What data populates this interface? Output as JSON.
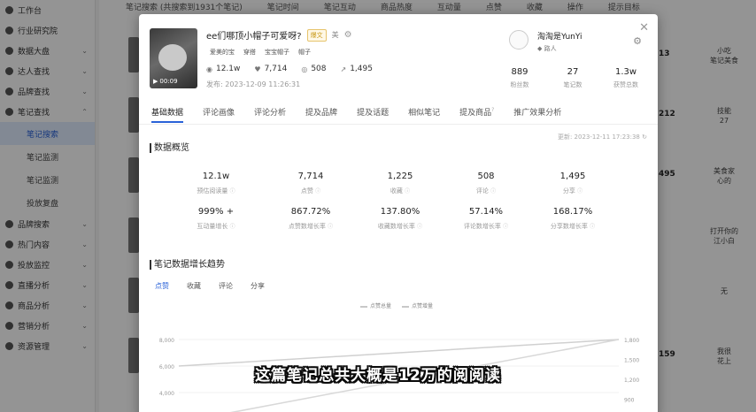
{
  "sidebar": {
    "items": [
      {
        "label": "工作台",
        "sub": false
      },
      {
        "label": "行业研究院",
        "sub": false
      },
      {
        "label": "数据大盘",
        "sub": false,
        "chevron": "⌄"
      },
      {
        "label": "达人查找",
        "sub": false,
        "chevron": "⌄"
      },
      {
        "label": "品牌查找",
        "sub": false,
        "chevron": "⌄"
      },
      {
        "label": "笔记查找",
        "sub": false,
        "chevron": "⌃"
      },
      {
        "label": "笔记搜索",
        "sub": true,
        "active": true
      },
      {
        "label": "笔记监测",
        "sub": true
      },
      {
        "label": "笔记监测",
        "sub": true
      },
      {
        "label": "投放复盘",
        "sub": true
      },
      {
        "label": "品牌搜索",
        "sub": false,
        "chevron": "⌄"
      },
      {
        "label": "热门内容",
        "sub": false,
        "chevron": "⌄"
      },
      {
        "label": "投放监控",
        "sub": false,
        "chevron": "⌄"
      },
      {
        "label": "直播分析",
        "sub": false,
        "chevron": "⌄"
      },
      {
        "label": "商品分析",
        "sub": false,
        "chevron": "⌄"
      },
      {
        "label": "营销分析",
        "sub": false,
        "chevron": "⌄"
      },
      {
        "label": "资源管理",
        "sub": false,
        "chevron": "⌄"
      }
    ]
  },
  "background": {
    "topbar": [
      "笔记搜索 (共搜索到1931个笔记)",
      "笔记时间",
      "笔记互动",
      "商品热度",
      "互动量",
      "点赞",
      "收藏",
      "操作",
      "提示目标"
    ],
    "rows": [
      {
        "num": "13",
        "txt": "小吃\n笔记美食"
      },
      {
        "num": "212",
        "txt": "技能\n27"
      },
      {
        "num": "495",
        "txt": "美食家\n心的"
      },
      {
        "num": "",
        "txt": "打开你的\n江小白"
      },
      {
        "num": "",
        "txt": "无"
      },
      {
        "num": "159",
        "txt": "我很\n花上"
      }
    ]
  },
  "modal": {
    "close_icon": "close-icon",
    "note": {
      "duration": "00:09",
      "title": "ee们哪顶小帽子可爱呀?",
      "badge": "爆文",
      "extra_label": "美",
      "tags": [
        "爱美的宝",
        "穿搭",
        "宝宝帽子",
        "帽子"
      ],
      "stats": {
        "views": "12.1w",
        "likes": "7,714",
        "comments": "508",
        "shares": "1,495"
      },
      "publish_time": "发布: 2023-12-09 11:26:31"
    },
    "author": {
      "name": "淘淘是YunYi",
      "level": "路人",
      "stats": [
        {
          "value": "889",
          "label": "粉丝数"
        },
        {
          "value": "27",
          "label": "笔记数"
        },
        {
          "value": "1.3w",
          "label": "获赞总数"
        }
      ]
    },
    "tabs": [
      {
        "label": "基础数据",
        "active": true
      },
      {
        "label": "评论画像"
      },
      {
        "label": "评论分析"
      },
      {
        "label": "提及品牌"
      },
      {
        "label": "提及话题"
      },
      {
        "label": "相似笔记"
      },
      {
        "label": "提及商品",
        "sup": "?"
      },
      {
        "label": "推广效果分析"
      }
    ],
    "updated": "更新: 2023-12-11 17:23:38",
    "overview": {
      "title": "数据概览",
      "metrics_row1": [
        {
          "value": "12.1w",
          "label": "预估阅读量"
        },
        {
          "value": "7,714",
          "label": "点赞"
        },
        {
          "value": "1,225",
          "label": "收藏"
        },
        {
          "value": "508",
          "label": "评论"
        },
        {
          "value": "1,495",
          "label": "分享"
        }
      ],
      "metrics_row2": [
        {
          "value": "999% +",
          "label": "互动量增长"
        },
        {
          "value": "867.72%",
          "label": "点赞数增长率"
        },
        {
          "value": "137.80%",
          "label": "收藏数增长率"
        },
        {
          "value": "57.14%",
          "label": "评论数增长率"
        },
        {
          "value": "168.17%",
          "label": "分享数增长率"
        }
      ]
    },
    "growth": {
      "title": "笔记数据增长趋势",
      "subtabs": [
        {
          "label": "点赞",
          "active": true
        },
        {
          "label": "收藏"
        },
        {
          "label": "评论"
        },
        {
          "label": "分享"
        }
      ],
      "legend": [
        "点赞总量",
        "点赞增量"
      ]
    }
  },
  "chart_data": {
    "type": "line",
    "title": "笔记数据增长趋势",
    "series": [
      {
        "name": "点赞总量",
        "values": [
          6000,
          8000
        ]
      },
      {
        "name": "点赞增量",
        "values": [
          550,
          1800
        ]
      }
    ],
    "y_left_ticks": [
      "8,000",
      "6,000",
      "4,000",
      "2,000"
    ],
    "y_right_ticks": [
      "1,800",
      "1,500",
      "1,200",
      "900",
      "600"
    ],
    "y_left_range": [
      2000,
      8000
    ],
    "y_right_range": [
      600,
      1800
    ]
  },
  "subtitle": "这篇笔记总共大概是12万的阅阅读"
}
